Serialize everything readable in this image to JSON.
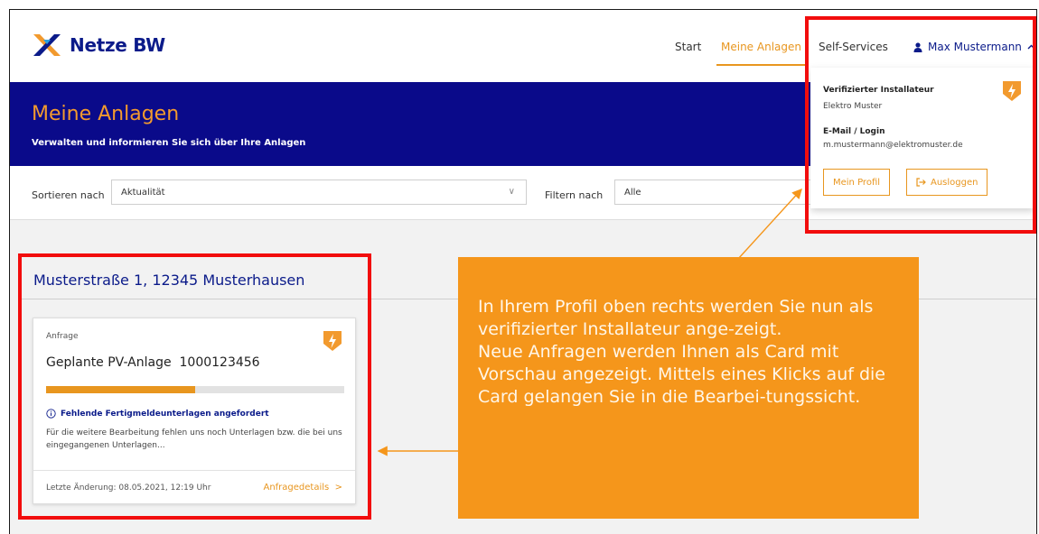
{
  "header": {
    "logo_text": "Netze BW",
    "logo_icon": "netze-bw-cross-logo",
    "nav": {
      "start": "Start",
      "anlagen": "Meine Anlagen",
      "self_services": "Self-Services",
      "user": "Max Mustermann",
      "user_icon": "person-icon",
      "chevron": "^"
    }
  },
  "hero": {
    "title": "Meine Anlagen",
    "subtitle": "Verwalten und informieren Sie sich über Ihre Anlagen"
  },
  "filter": {
    "sort_label": "Sortieren nach",
    "sort_value": "Aktualität",
    "filter_label": "Filtern nach",
    "filter_value": "Alle",
    "chevron": "∨"
  },
  "content": {
    "address": "Musterstraße 1, 12345 Musterhausen",
    "card": {
      "category": "Anfrage",
      "title": "Geplante PV-Anlage",
      "number": "1000123456",
      "progress_fraction": 0.5,
      "warning": "Fehlende Fertigmeldeunterlagen angefordert",
      "warning_icon": "info-circle-icon",
      "description": "Für die weitere Bearbeitung fehlen uns noch Unterlagen bzw. die bei uns eingegangenen Unterlagen...",
      "last_change": "Letzte Änderung: 08.05.2021, 12:19 Uhr",
      "link": "Anfragedetails",
      "link_chevron": ">",
      "badge_icon": "lightning-shield-icon"
    }
  },
  "dropdown": {
    "role": "Verifizierter Installateur",
    "company": "Elektro Muster",
    "email_label": "E-Mail / Login",
    "email": "m.mustermann@elektromuster.de",
    "profile_button": "Mein Profil",
    "logout_button": "Ausloggen",
    "logout_icon": "logout-icon",
    "badge_icon": "lightning-shield-icon"
  },
  "callout": {
    "text": "In Ihrem Profil oben rechts werden Sie nun als verifizierter Installateur ange-zeigt.\nNeue Anfragen werden Ihnen als Card mit Vorschau angezeigt. Mittels eines Klicks auf die Card gelangen Sie in die Bearbei-tungssicht."
  },
  "colors": {
    "brand_blue": "#0a0a8a",
    "accent_orange": "#e8961f",
    "callout_orange": "#f5961b",
    "highlight_red": "#f20d0d"
  }
}
